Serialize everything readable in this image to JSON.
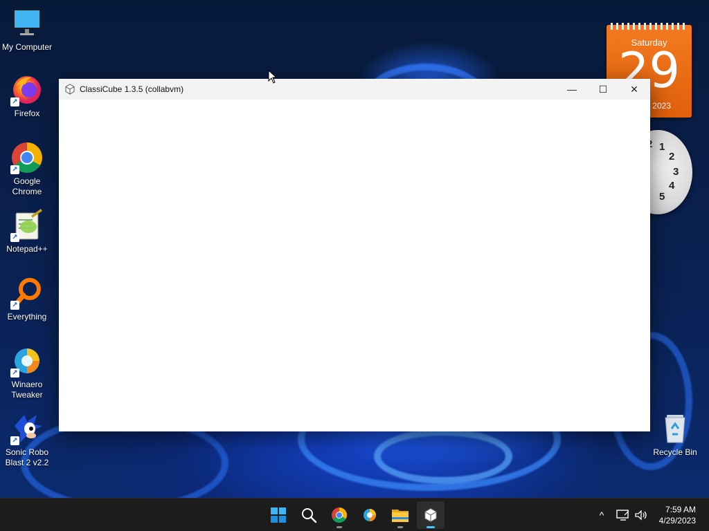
{
  "desktop": {
    "icons": [
      {
        "id": "my-computer",
        "label": "My Computer",
        "icon": "monitor-icon"
      },
      {
        "id": "firefox",
        "label": "Firefox",
        "icon": "firefox-icon"
      },
      {
        "id": "google-chrome",
        "label": "Google Chrome",
        "icon": "chrome-icon"
      },
      {
        "id": "notepadpp",
        "label": "Notepad++",
        "icon": "notepadpp-icon"
      },
      {
        "id": "everything",
        "label": "Everything",
        "icon": "everything-search-icon"
      },
      {
        "id": "winaero-tweaker",
        "label": "Winaero Tweaker",
        "icon": "winaero-tweaker-icon"
      },
      {
        "id": "sonic-robo-blast",
        "label": "Sonic Robo Blast 2 v2.2",
        "icon": "sonic-icon"
      },
      {
        "id": "recycle-bin",
        "label": "Recycle Bin",
        "icon": "recycle-bin-icon"
      }
    ],
    "shortcut_arrow": "↗"
  },
  "window": {
    "title": "ClassiCube 1.3.5 (collabvm)",
    "minimize": "—",
    "maximize": "☐",
    "close": "✕"
  },
  "gadgets": {
    "calendar": {
      "weekday": "Saturday",
      "day": "29",
      "year": "2023"
    },
    "clock": {
      "numerals": [
        "2",
        "1",
        "2",
        "3",
        "4",
        "5"
      ]
    }
  },
  "taskbar": {
    "apps": [
      {
        "id": "start",
        "icon": "windows-start-icon"
      },
      {
        "id": "search",
        "icon": "search-icon"
      },
      {
        "id": "chrome",
        "icon": "chrome-icon"
      },
      {
        "id": "winaero",
        "icon": "winaero-tweaker-icon"
      },
      {
        "id": "explorer",
        "icon": "folder-icon"
      },
      {
        "id": "classicube",
        "icon": "classicube-icon"
      }
    ],
    "tray": {
      "chevron": "^"
    },
    "time": "7:59 AM",
    "date": "4/29/2023"
  },
  "colors": {
    "taskbar_bg": "#1c1c1c",
    "active_indicator": "#4cc2ff",
    "calendar_orange": "#f07018",
    "wallpaper_blue": "#1f5cf0"
  }
}
